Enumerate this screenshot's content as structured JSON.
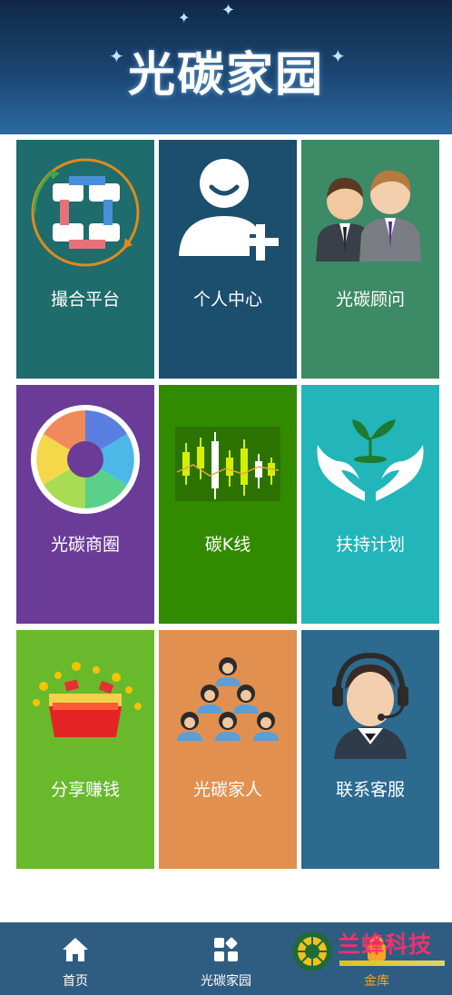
{
  "header": {
    "title": "光碳家园"
  },
  "tiles": [
    {
      "label": "撮合平台",
      "color": "#1e6c6c",
      "icon": "handshake-circle-icon"
    },
    {
      "label": "个人中心",
      "color": "#1c4e6e",
      "icon": "add-user-icon"
    },
    {
      "label": "光碳顾问",
      "color": "#3c8a66",
      "icon": "advisors-icon"
    },
    {
      "label": "光碳商圈",
      "color": "#6a3c97",
      "icon": "aperture-icon"
    },
    {
      "label": "碳K线",
      "color": "#318a00",
      "icon": "candlestick-icon"
    },
    {
      "label": "扶持计划",
      "color": "#22b5ba",
      "icon": "hands-sprout-icon"
    },
    {
      "label": "分享赚钱",
      "color": "#69b92c",
      "icon": "red-envelope-icon"
    },
    {
      "label": "光碳家人",
      "color": "#e1904f",
      "icon": "people-pyramid-icon"
    },
    {
      "label": "联系客服",
      "color": "#2d6a90",
      "icon": "customer-service-icon"
    }
  ],
  "footer": {
    "items": [
      {
        "label": "首页",
        "icon": "home-icon",
        "active": false
      },
      {
        "label": "光碳家园",
        "icon": "grid-apps-icon",
        "active": false
      },
      {
        "label": "金库",
        "icon": "vault-icon",
        "active": true
      }
    ]
  },
  "watermark": {
    "text": "兰蜂科技"
  }
}
